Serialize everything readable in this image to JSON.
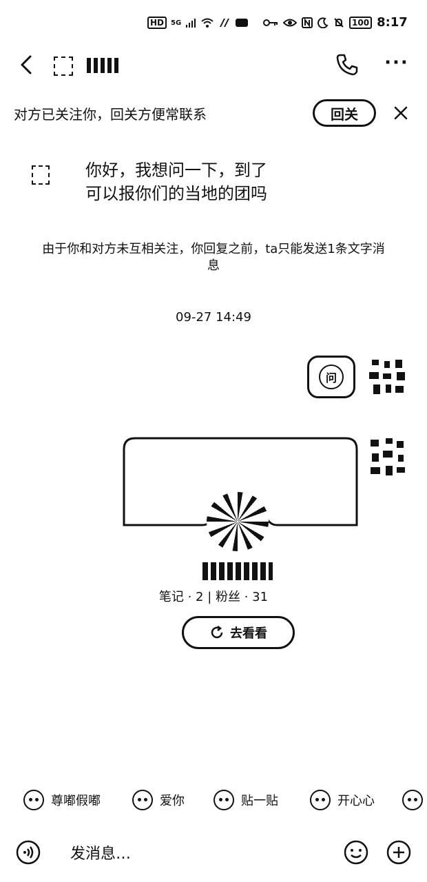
{
  "status_bar": {
    "left_badges": [
      "HD",
      "5G"
    ],
    "battery": "100",
    "time": "8:17"
  },
  "banner": {
    "text": "对方已关注你，回关方便常联系",
    "follow_back_label": "回关"
  },
  "chat": {
    "incoming_message": "你好，我想问一下，到了\n可以报你们的当地的团吗",
    "notice": "由于你和对方未互相关注，你回复之前，ta只能发送1条文字消息",
    "timestamp": "09-27 14:49",
    "ask_bubble_glyph": "问"
  },
  "profile_card": {
    "stats": "笔记 · 2  |  粉丝 · 31",
    "go_label": "去看看"
  },
  "stickers": [
    {
      "label": "尊嘟假嘟"
    },
    {
      "label": "爱你"
    },
    {
      "label": "贴一贴"
    },
    {
      "label": "开心心"
    }
  ],
  "composer": {
    "placeholder": "发消息…"
  }
}
